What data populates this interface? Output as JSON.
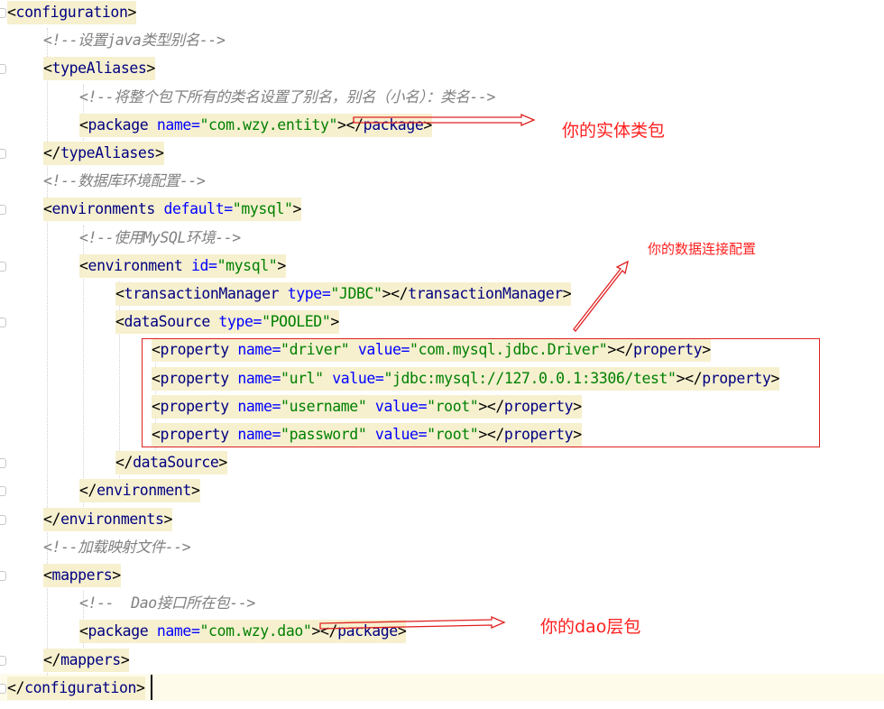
{
  "code": {
    "lines": [
      {
        "indent": 0,
        "segs": [
          [
            "br",
            "<"
          ],
          [
            "tag",
            "configuration"
          ],
          [
            "br",
            ">"
          ]
        ]
      },
      {
        "indent": 1,
        "segs": [
          [
            "cmt",
            "<!--设置java类型别名-->"
          ]
        ]
      },
      {
        "indent": 1,
        "segs": [
          [
            "br",
            "<"
          ],
          [
            "tag",
            "typeAliases"
          ],
          [
            "br",
            ">"
          ]
        ]
      },
      {
        "indent": 2,
        "segs": [
          [
            "cmt",
            "<!--将整个包下所有的类名设置了别名，别名（小名）：类名-->"
          ]
        ]
      },
      {
        "indent": 2,
        "segs": [
          [
            "br",
            "<"
          ],
          [
            "tag",
            "package "
          ],
          [
            "attr",
            "name="
          ],
          [
            "val",
            "\"com.wzy.entity\""
          ],
          [
            "br",
            "></"
          ],
          [
            "tag",
            "package"
          ],
          [
            "br",
            ">"
          ]
        ]
      },
      {
        "indent": 1,
        "segs": [
          [
            "br",
            "</"
          ],
          [
            "tag",
            "typeAliases"
          ],
          [
            "br",
            ">"
          ]
        ]
      },
      {
        "indent": 1,
        "segs": [
          [
            "cmt",
            "<!--数据库环境配置-->"
          ]
        ]
      },
      {
        "indent": 1,
        "segs": [
          [
            "br",
            "<"
          ],
          [
            "tag",
            "environments "
          ],
          [
            "attr",
            "default="
          ],
          [
            "val",
            "\"mysql\""
          ],
          [
            "br",
            ">"
          ]
        ]
      },
      {
        "indent": 2,
        "segs": [
          [
            "cmt",
            "<!--使用MySQL环境-->"
          ]
        ]
      },
      {
        "indent": 2,
        "segs": [
          [
            "br",
            "<"
          ],
          [
            "tag",
            "environment "
          ],
          [
            "attr",
            "id="
          ],
          [
            "val",
            "\"mysql\""
          ],
          [
            "br",
            ">"
          ]
        ]
      },
      {
        "indent": 3,
        "segs": [
          [
            "br",
            "<"
          ],
          [
            "tag",
            "transactionManager "
          ],
          [
            "attr",
            "type="
          ],
          [
            "val",
            "\"JDBC\""
          ],
          [
            "br",
            "></"
          ],
          [
            "tag",
            "transactionManager"
          ],
          [
            "br",
            ">"
          ]
        ]
      },
      {
        "indent": 3,
        "segs": [
          [
            "br",
            "<"
          ],
          [
            "tag",
            "dataSource "
          ],
          [
            "attr",
            "type="
          ],
          [
            "val",
            "\"POOLED\""
          ],
          [
            "br",
            ">"
          ]
        ]
      },
      {
        "indent": 4,
        "segs": [
          [
            "br",
            "<"
          ],
          [
            "tag",
            "property "
          ],
          [
            "attr",
            "name="
          ],
          [
            "val",
            "\"driver\" "
          ],
          [
            "attr",
            "value="
          ],
          [
            "val",
            "\"com.mysql.jdbc.Driver\""
          ],
          [
            "br",
            "></"
          ],
          [
            "tag",
            "property"
          ],
          [
            "br",
            ">"
          ]
        ]
      },
      {
        "indent": 4,
        "segs": [
          [
            "br",
            "<"
          ],
          [
            "tag",
            "property "
          ],
          [
            "attr",
            "name="
          ],
          [
            "val",
            "\"url\" "
          ],
          [
            "attr",
            "value="
          ],
          [
            "val",
            "\"jdbc:mysql://127.0.0.1:3306/test\""
          ],
          [
            "br",
            "></"
          ],
          [
            "tag",
            "property"
          ],
          [
            "br",
            ">"
          ]
        ]
      },
      {
        "indent": 4,
        "segs": [
          [
            "br",
            "<"
          ],
          [
            "tag",
            "property "
          ],
          [
            "attr",
            "name="
          ],
          [
            "val",
            "\"username\" "
          ],
          [
            "attr",
            "value="
          ],
          [
            "val",
            "\"root\""
          ],
          [
            "br",
            "></"
          ],
          [
            "tag",
            "property"
          ],
          [
            "br",
            ">"
          ]
        ]
      },
      {
        "indent": 4,
        "segs": [
          [
            "br",
            "<"
          ],
          [
            "tag",
            "property "
          ],
          [
            "attr",
            "name="
          ],
          [
            "val",
            "\"password\" "
          ],
          [
            "attr",
            "value="
          ],
          [
            "val",
            "\"root\""
          ],
          [
            "br",
            "></"
          ],
          [
            "tag",
            "property"
          ],
          [
            "br",
            ">"
          ]
        ]
      },
      {
        "indent": 3,
        "segs": [
          [
            "br",
            "</"
          ],
          [
            "tag",
            "dataSource"
          ],
          [
            "br",
            ">"
          ]
        ]
      },
      {
        "indent": 2,
        "segs": [
          [
            "br",
            "</"
          ],
          [
            "tag",
            "environment"
          ],
          [
            "br",
            ">"
          ]
        ]
      },
      {
        "indent": 1,
        "segs": [
          [
            "br",
            "</"
          ],
          [
            "tag",
            "environments"
          ],
          [
            "br",
            ">"
          ]
        ]
      },
      {
        "indent": 1,
        "segs": [
          [
            "cmt",
            "<!--加载映射文件-->"
          ]
        ]
      },
      {
        "indent": 1,
        "segs": [
          [
            "br",
            "<"
          ],
          [
            "tag",
            "mappers"
          ],
          [
            "br",
            ">"
          ]
        ]
      },
      {
        "indent": 2,
        "segs": [
          [
            "cmt",
            "<!--  Dao接口所在包-->"
          ]
        ]
      },
      {
        "indent": 2,
        "segs": [
          [
            "br",
            "<"
          ],
          [
            "tag",
            "package "
          ],
          [
            "attr",
            "name="
          ],
          [
            "val",
            "\"com.wzy.dao\""
          ],
          [
            "br",
            "></"
          ],
          [
            "tag",
            "package"
          ],
          [
            "br",
            ">"
          ]
        ]
      },
      {
        "indent": 1,
        "segs": [
          [
            "br",
            "</"
          ],
          [
            "tag",
            "mappers"
          ],
          [
            "br",
            ">"
          ]
        ]
      },
      {
        "indent": 0,
        "segs": [
          [
            "br",
            "</"
          ],
          [
            "tag",
            "configuration"
          ],
          [
            "br",
            ">"
          ]
        ]
      }
    ]
  },
  "annotations": {
    "entity_note": "你的实体类包",
    "datasource_note": "你的数据连接配置",
    "dao_note": "你的dao层包"
  },
  "colors": {
    "tag": "#000080",
    "attr": "#0000ff",
    "value": "#008000",
    "comment": "#808080",
    "annotation": "#ff2020",
    "tag_highlight": "#f6f0cf"
  }
}
